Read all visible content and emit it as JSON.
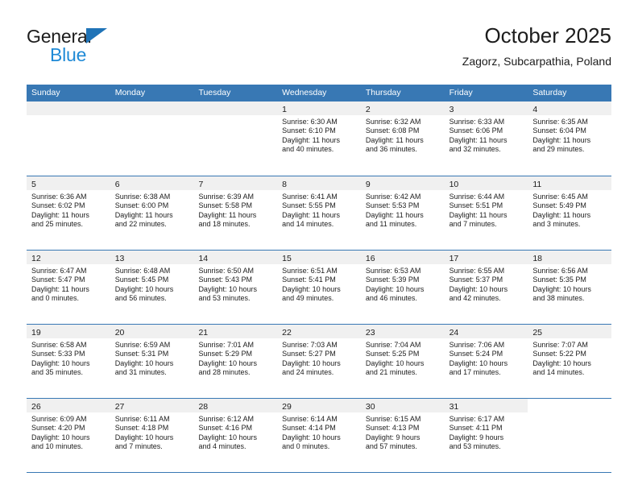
{
  "brand": {
    "word_one": "General",
    "word_two": "Blue",
    "triangle_icon": "brand-triangle-icon",
    "accent_dark": "#1f73b7",
    "accent_light": "#1f8ad6"
  },
  "header": {
    "title": "October 2025",
    "subtitle": "Zagorz, Subcarpathia, Poland"
  },
  "theme": {
    "header_row_bg": "#3878b4",
    "daynum_strip_bg": "#f0f0f0",
    "grid_line": "#3878b4",
    "text": "#1c1c1c"
  },
  "weekdays": [
    "Sunday",
    "Monday",
    "Tuesday",
    "Wednesday",
    "Thursday",
    "Friday",
    "Saturday"
  ],
  "labels": {
    "sunrise_prefix": "Sunrise:",
    "sunset_prefix": "Sunset:",
    "daylight_prefix": "Daylight:"
  },
  "weeks": [
    [
      {
        "day": "",
        "state": "blank"
      },
      {
        "day": "",
        "state": "blank"
      },
      {
        "day": "",
        "state": "blank"
      },
      {
        "day": "1",
        "sunrise": "Sunrise: 6:30 AM",
        "sunset": "Sunset: 6:10 PM",
        "daylight_line1": "Daylight: 11 hours",
        "daylight_line2": "and 40 minutes."
      },
      {
        "day": "2",
        "sunrise": "Sunrise: 6:32 AM",
        "sunset": "Sunset: 6:08 PM",
        "daylight_line1": "Daylight: 11 hours",
        "daylight_line2": "and 36 minutes."
      },
      {
        "day": "3",
        "sunrise": "Sunrise: 6:33 AM",
        "sunset": "Sunset: 6:06 PM",
        "daylight_line1": "Daylight: 11 hours",
        "daylight_line2": "and 32 minutes."
      },
      {
        "day": "4",
        "sunrise": "Sunrise: 6:35 AM",
        "sunset": "Sunset: 6:04 PM",
        "daylight_line1": "Daylight: 11 hours",
        "daylight_line2": "and 29 minutes."
      }
    ],
    [
      {
        "day": "5",
        "sunrise": "Sunrise: 6:36 AM",
        "sunset": "Sunset: 6:02 PM",
        "daylight_line1": "Daylight: 11 hours",
        "daylight_line2": "and 25 minutes."
      },
      {
        "day": "6",
        "sunrise": "Sunrise: 6:38 AM",
        "sunset": "Sunset: 6:00 PM",
        "daylight_line1": "Daylight: 11 hours",
        "daylight_line2": "and 22 minutes."
      },
      {
        "day": "7",
        "sunrise": "Sunrise: 6:39 AM",
        "sunset": "Sunset: 5:58 PM",
        "daylight_line1": "Daylight: 11 hours",
        "daylight_line2": "and 18 minutes."
      },
      {
        "day": "8",
        "sunrise": "Sunrise: 6:41 AM",
        "sunset": "Sunset: 5:55 PM",
        "daylight_line1": "Daylight: 11 hours",
        "daylight_line2": "and 14 minutes."
      },
      {
        "day": "9",
        "sunrise": "Sunrise: 6:42 AM",
        "sunset": "Sunset: 5:53 PM",
        "daylight_line1": "Daylight: 11 hours",
        "daylight_line2": "and 11 minutes."
      },
      {
        "day": "10",
        "sunrise": "Sunrise: 6:44 AM",
        "sunset": "Sunset: 5:51 PM",
        "daylight_line1": "Daylight: 11 hours",
        "daylight_line2": "and 7 minutes."
      },
      {
        "day": "11",
        "sunrise": "Sunrise: 6:45 AM",
        "sunset": "Sunset: 5:49 PM",
        "daylight_line1": "Daylight: 11 hours",
        "daylight_line2": "and 3 minutes."
      }
    ],
    [
      {
        "day": "12",
        "sunrise": "Sunrise: 6:47 AM",
        "sunset": "Sunset: 5:47 PM",
        "daylight_line1": "Daylight: 11 hours",
        "daylight_line2": "and 0 minutes."
      },
      {
        "day": "13",
        "sunrise": "Sunrise: 6:48 AM",
        "sunset": "Sunset: 5:45 PM",
        "daylight_line1": "Daylight: 10 hours",
        "daylight_line2": "and 56 minutes."
      },
      {
        "day": "14",
        "sunrise": "Sunrise: 6:50 AM",
        "sunset": "Sunset: 5:43 PM",
        "daylight_line1": "Daylight: 10 hours",
        "daylight_line2": "and 53 minutes."
      },
      {
        "day": "15",
        "sunrise": "Sunrise: 6:51 AM",
        "sunset": "Sunset: 5:41 PM",
        "daylight_line1": "Daylight: 10 hours",
        "daylight_line2": "and 49 minutes."
      },
      {
        "day": "16",
        "sunrise": "Sunrise: 6:53 AM",
        "sunset": "Sunset: 5:39 PM",
        "daylight_line1": "Daylight: 10 hours",
        "daylight_line2": "and 46 minutes."
      },
      {
        "day": "17",
        "sunrise": "Sunrise: 6:55 AM",
        "sunset": "Sunset: 5:37 PM",
        "daylight_line1": "Daylight: 10 hours",
        "daylight_line2": "and 42 minutes."
      },
      {
        "day": "18",
        "sunrise": "Sunrise: 6:56 AM",
        "sunset": "Sunset: 5:35 PM",
        "daylight_line1": "Daylight: 10 hours",
        "daylight_line2": "and 38 minutes."
      }
    ],
    [
      {
        "day": "19",
        "sunrise": "Sunrise: 6:58 AM",
        "sunset": "Sunset: 5:33 PM",
        "daylight_line1": "Daylight: 10 hours",
        "daylight_line2": "and 35 minutes."
      },
      {
        "day": "20",
        "sunrise": "Sunrise: 6:59 AM",
        "sunset": "Sunset: 5:31 PM",
        "daylight_line1": "Daylight: 10 hours",
        "daylight_line2": "and 31 minutes."
      },
      {
        "day": "21",
        "sunrise": "Sunrise: 7:01 AM",
        "sunset": "Sunset: 5:29 PM",
        "daylight_line1": "Daylight: 10 hours",
        "daylight_line2": "and 28 minutes."
      },
      {
        "day": "22",
        "sunrise": "Sunrise: 7:03 AM",
        "sunset": "Sunset: 5:27 PM",
        "daylight_line1": "Daylight: 10 hours",
        "daylight_line2": "and 24 minutes."
      },
      {
        "day": "23",
        "sunrise": "Sunrise: 7:04 AM",
        "sunset": "Sunset: 5:25 PM",
        "daylight_line1": "Daylight: 10 hours",
        "daylight_line2": "and 21 minutes."
      },
      {
        "day": "24",
        "sunrise": "Sunrise: 7:06 AM",
        "sunset": "Sunset: 5:24 PM",
        "daylight_line1": "Daylight: 10 hours",
        "daylight_line2": "and 17 minutes."
      },
      {
        "day": "25",
        "sunrise": "Sunrise: 7:07 AM",
        "sunset": "Sunset: 5:22 PM",
        "daylight_line1": "Daylight: 10 hours",
        "daylight_line2": "and 14 minutes."
      }
    ],
    [
      {
        "day": "26",
        "sunrise": "Sunrise: 6:09 AM",
        "sunset": "Sunset: 4:20 PM",
        "daylight_line1": "Daylight: 10 hours",
        "daylight_line2": "and 10 minutes."
      },
      {
        "day": "27",
        "sunrise": "Sunrise: 6:11 AM",
        "sunset": "Sunset: 4:18 PM",
        "daylight_line1": "Daylight: 10 hours",
        "daylight_line2": "and 7 minutes."
      },
      {
        "day": "28",
        "sunrise": "Sunrise: 6:12 AM",
        "sunset": "Sunset: 4:16 PM",
        "daylight_line1": "Daylight: 10 hours",
        "daylight_line2": "and 4 minutes."
      },
      {
        "day": "29",
        "sunrise": "Sunrise: 6:14 AM",
        "sunset": "Sunset: 4:14 PM",
        "daylight_line1": "Daylight: 10 hours",
        "daylight_line2": "and 0 minutes."
      },
      {
        "day": "30",
        "sunrise": "Sunrise: 6:15 AM",
        "sunset": "Sunset: 4:13 PM",
        "daylight_line1": "Daylight: 9 hours",
        "daylight_line2": "and 57 minutes."
      },
      {
        "day": "31",
        "sunrise": "Sunrise: 6:17 AM",
        "sunset": "Sunset: 4:11 PM",
        "daylight_line1": "Daylight: 9 hours",
        "daylight_line2": "and 53 minutes."
      },
      {
        "day": "",
        "state": "empty"
      }
    ]
  ]
}
